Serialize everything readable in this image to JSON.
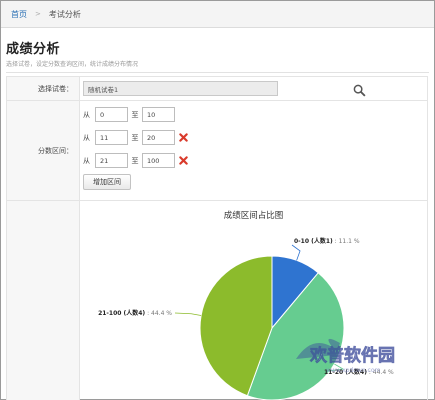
{
  "breadcrumb": {
    "home": "首页",
    "separator": ">",
    "current": "考试分析"
  },
  "page": {
    "title": "成绩分析",
    "description": "选择试卷，设定分数查询区间，统计成绩分布情况"
  },
  "form": {
    "paper_label": "选择试卷：",
    "paper_value": "随机试卷1",
    "range_label": "分数区间：",
    "from_label": "从",
    "to_label": "至",
    "ranges": [
      {
        "from": "0",
        "to": "10",
        "removable": false
      },
      {
        "from": "11",
        "to": "20",
        "removable": true
      },
      {
        "from": "21",
        "to": "100",
        "removable": true
      }
    ],
    "add_button": "增加区间"
  },
  "colors": {
    "accent": "#2a6fb4",
    "remove": "#d93a2b"
  },
  "chart_data": {
    "type": "pie",
    "title": "成绩区间占比图",
    "slices": [
      {
        "label": "0-10 (人数1)",
        "value_text": "11.1 %",
        "value": 11.1,
        "color": "#2f74d0"
      },
      {
        "label": "11-20 (人数4)",
        "value_text": "44.4 %",
        "value": 44.4,
        "color": "#66cc90"
      },
      {
        "label": "21-100 (人数4)",
        "value_text": "44.4 %",
        "value": 44.4,
        "color": "#8cbb2c"
      }
    ]
  },
  "watermark": {
    "text": "欢普软件园",
    "url": "www.xpdown.com"
  }
}
